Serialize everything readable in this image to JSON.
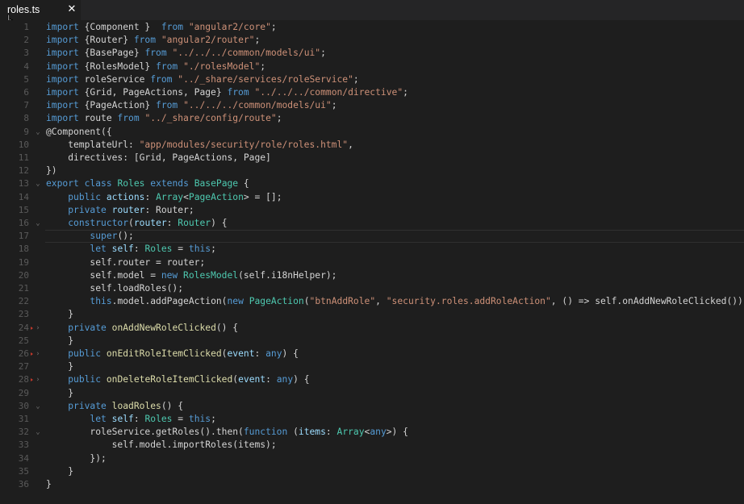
{
  "tab": {
    "title": "roles.ts",
    "close_glyph": "✕"
  },
  "colors": {
    "background": "#1e1e1e",
    "tabbar": "#252526",
    "line_number": "#5a5a5a",
    "keyword": "#569cd6",
    "type": "#4ec9b0",
    "string": "#ce9178",
    "function": "#dcdcaa",
    "text": "#d4d4d4",
    "marker": "#c0392b"
  },
  "lines": [
    {
      "n": "1",
      "tokens": [
        [
          "kw",
          "import"
        ],
        [
          "pu",
          " {Component }  "
        ],
        [
          "kw",
          "from"
        ],
        [
          "pu",
          " "
        ],
        [
          "str",
          "\"angular2/core\""
        ],
        [
          "pu",
          ";"
        ]
      ]
    },
    {
      "n": "2",
      "tokens": [
        [
          "kw",
          "import"
        ],
        [
          "pu",
          " {Router} "
        ],
        [
          "kw",
          "from"
        ],
        [
          "pu",
          " "
        ],
        [
          "str",
          "\"angular2/router\""
        ],
        [
          "pu",
          ";"
        ]
      ]
    },
    {
      "n": "3",
      "tokens": [
        [
          "kw",
          "import"
        ],
        [
          "pu",
          " {BasePage} "
        ],
        [
          "kw",
          "from"
        ],
        [
          "pu",
          " "
        ],
        [
          "str",
          "\"../../../common/models/ui\""
        ],
        [
          "pu",
          ";"
        ]
      ]
    },
    {
      "n": "4",
      "tokens": [
        [
          "kw",
          "import"
        ],
        [
          "pu",
          " {RolesModel} "
        ],
        [
          "kw",
          "from"
        ],
        [
          "pu",
          " "
        ],
        [
          "str",
          "\"./rolesModel\""
        ],
        [
          "pu",
          ";"
        ]
      ]
    },
    {
      "n": "5",
      "tokens": [
        [
          "kw",
          "import"
        ],
        [
          "pu",
          " roleService "
        ],
        [
          "kw",
          "from"
        ],
        [
          "pu",
          " "
        ],
        [
          "str",
          "\"../_share/services/roleService\""
        ],
        [
          "pu",
          ";"
        ]
      ]
    },
    {
      "n": "6",
      "tokens": [
        [
          "kw",
          "import"
        ],
        [
          "pu",
          " {Grid, PageActions, Page} "
        ],
        [
          "kw",
          "from"
        ],
        [
          "pu",
          " "
        ],
        [
          "str",
          "\"../../../common/directive\""
        ],
        [
          "pu",
          ";"
        ]
      ]
    },
    {
      "n": "7",
      "tokens": [
        [
          "kw",
          "import"
        ],
        [
          "pu",
          " {PageAction} "
        ],
        [
          "kw",
          "from"
        ],
        [
          "pu",
          " "
        ],
        [
          "str",
          "\"../../../common/models/ui\""
        ],
        [
          "pu",
          ";"
        ]
      ]
    },
    {
      "n": "8",
      "tokens": [
        [
          "kw",
          "import"
        ],
        [
          "pu",
          " route "
        ],
        [
          "kw",
          "from"
        ],
        [
          "pu",
          " "
        ],
        [
          "str",
          "\"../_share/config/route\""
        ],
        [
          "pu",
          ";"
        ]
      ]
    },
    {
      "n": "9",
      "fold": "⌄",
      "tokens": [
        [
          "pu",
          "@Component({"
        ]
      ]
    },
    {
      "n": "10",
      "tokens": [
        [
          "pu",
          "    templateUrl: "
        ],
        [
          "str",
          "\"app/modules/security/role/roles.html\""
        ],
        [
          "pu",
          ","
        ]
      ]
    },
    {
      "n": "11",
      "tokens": [
        [
          "pu",
          "    directives: [Grid, PageActions, Page]"
        ]
      ]
    },
    {
      "n": "12",
      "tokens": [
        [
          "pu",
          "})"
        ]
      ]
    },
    {
      "n": "13",
      "fold": "⌄",
      "tokens": [
        [
          "kw",
          "export"
        ],
        [
          "pu",
          " "
        ],
        [
          "kw",
          "class"
        ],
        [
          "pu",
          " "
        ],
        [
          "ty",
          "Roles"
        ],
        [
          "pu",
          " "
        ],
        [
          "kw",
          "extends"
        ],
        [
          "pu",
          " "
        ],
        [
          "ty",
          "BasePage"
        ],
        [
          "pu",
          " {"
        ]
      ]
    },
    {
      "n": "14",
      "tokens": [
        [
          "pu",
          "    "
        ],
        [
          "kw",
          "public"
        ],
        [
          "pu",
          " "
        ],
        [
          "pm",
          "actions"
        ],
        [
          "pu",
          ": "
        ],
        [
          "ty",
          "Array"
        ],
        [
          "pu",
          "<"
        ],
        [
          "ty",
          "PageAction"
        ],
        [
          "pu",
          "> = [];"
        ]
      ]
    },
    {
      "n": "15",
      "tokens": [
        [
          "pu",
          "    "
        ],
        [
          "kw",
          "private"
        ],
        [
          "pu",
          " "
        ],
        [
          "pm",
          "router"
        ],
        [
          "pu",
          ": Router;"
        ]
      ]
    },
    {
      "n": "16",
      "fold": "⌄",
      "tokens": [
        [
          "pu",
          "    "
        ],
        [
          "kw",
          "constructor"
        ],
        [
          "pu",
          "("
        ],
        [
          "pm",
          "router"
        ],
        [
          "pu",
          ": "
        ],
        [
          "ty",
          "Router"
        ],
        [
          "pu",
          ") {"
        ]
      ]
    },
    {
      "n": "17",
      "current": true,
      "tokens": [
        [
          "pu",
          "        "
        ],
        [
          "kw",
          "super"
        ],
        [
          "pu",
          "();"
        ]
      ]
    },
    {
      "n": "18",
      "tokens": [
        [
          "pu",
          "        "
        ],
        [
          "kw",
          "let"
        ],
        [
          "pu",
          " "
        ],
        [
          "pm",
          "self"
        ],
        [
          "pu",
          ": "
        ],
        [
          "ty",
          "Roles"
        ],
        [
          "pu",
          " = "
        ],
        [
          "kw",
          "this"
        ],
        [
          "pu",
          ";"
        ]
      ]
    },
    {
      "n": "19",
      "tokens": [
        [
          "pu",
          "        self.router = router;"
        ]
      ]
    },
    {
      "n": "20",
      "tokens": [
        [
          "pu",
          "        self.model = "
        ],
        [
          "kw",
          "new"
        ],
        [
          "pu",
          " "
        ],
        [
          "ty",
          "RolesModel"
        ],
        [
          "pu",
          "(self.i18nHelper);"
        ]
      ]
    },
    {
      "n": "21",
      "tokens": [
        [
          "pu",
          "        self.loadRoles();"
        ]
      ]
    },
    {
      "n": "22",
      "tokens": [
        [
          "pu",
          "        "
        ],
        [
          "kw",
          "this"
        ],
        [
          "pu",
          ".model.addPageAction("
        ],
        [
          "kw",
          "new"
        ],
        [
          "pu",
          " "
        ],
        [
          "ty",
          "PageAction"
        ],
        [
          "pu",
          "("
        ],
        [
          "str",
          "\"btnAddRole\""
        ],
        [
          "pu",
          ", "
        ],
        [
          "str",
          "\"security.roles.addRoleAction\""
        ],
        [
          "pu",
          ", () => self.onAddNewRoleClicked()));"
        ]
      ]
    },
    {
      "n": "23",
      "tokens": [
        [
          "pu",
          "    }"
        ]
      ]
    },
    {
      "n": "24",
      "fold": "›",
      "marker": true,
      "tokens": [
        [
          "pu",
          "    "
        ],
        [
          "kw",
          "private"
        ],
        [
          "pu",
          " "
        ],
        [
          "fn",
          "onAddNewRoleClicked"
        ],
        [
          "pu",
          "() {"
        ]
      ]
    },
    {
      "n": "25",
      "tokens": [
        [
          "pu",
          "    }"
        ]
      ]
    },
    {
      "n": "26",
      "fold": "›",
      "marker": true,
      "tokens": [
        [
          "pu",
          "    "
        ],
        [
          "kw",
          "public"
        ],
        [
          "pu",
          " "
        ],
        [
          "fn",
          "onEditRoleItemClicked"
        ],
        [
          "pu",
          "("
        ],
        [
          "pm",
          "event"
        ],
        [
          "pu",
          ": "
        ],
        [
          "kw",
          "any"
        ],
        [
          "pu",
          ") {"
        ]
      ]
    },
    {
      "n": "27",
      "tokens": [
        [
          "pu",
          "    }"
        ]
      ]
    },
    {
      "n": "28",
      "fold": "›",
      "marker": true,
      "tokens": [
        [
          "pu",
          "    "
        ],
        [
          "kw",
          "public"
        ],
        [
          "pu",
          " "
        ],
        [
          "fn",
          "onDeleteRoleItemClicked"
        ],
        [
          "pu",
          "("
        ],
        [
          "pm",
          "event"
        ],
        [
          "pu",
          ": "
        ],
        [
          "kw",
          "any"
        ],
        [
          "pu",
          ") {"
        ]
      ]
    },
    {
      "n": "29",
      "tokens": [
        [
          "pu",
          "    }"
        ]
      ]
    },
    {
      "n": "30",
      "fold": "⌄",
      "tokens": [
        [
          "pu",
          "    "
        ],
        [
          "kw",
          "private"
        ],
        [
          "pu",
          " "
        ],
        [
          "fn",
          "loadRoles"
        ],
        [
          "pu",
          "() {"
        ]
      ]
    },
    {
      "n": "31",
      "tokens": [
        [
          "pu",
          "        "
        ],
        [
          "kw",
          "let"
        ],
        [
          "pu",
          " "
        ],
        [
          "pm",
          "self"
        ],
        [
          "pu",
          ": "
        ],
        [
          "ty",
          "Roles"
        ],
        [
          "pu",
          " = "
        ],
        [
          "kw",
          "this"
        ],
        [
          "pu",
          ";"
        ]
      ]
    },
    {
      "n": "32",
      "fold": "⌄",
      "tokens": [
        [
          "pu",
          "        roleService.getRoles().then("
        ],
        [
          "kw",
          "function"
        ],
        [
          "pu",
          " ("
        ],
        [
          "pm",
          "items"
        ],
        [
          "pu",
          ": "
        ],
        [
          "ty",
          "Array"
        ],
        [
          "pu",
          "<"
        ],
        [
          "kw",
          "any"
        ],
        [
          "pu",
          ">) {"
        ]
      ]
    },
    {
      "n": "33",
      "tokens": [
        [
          "pu",
          "            self.model.importRoles(items);"
        ]
      ]
    },
    {
      "n": "34",
      "tokens": [
        [
          "pu",
          "        });"
        ]
      ]
    },
    {
      "n": "35",
      "tokens": [
        [
          "pu",
          "    }"
        ]
      ]
    },
    {
      "n": "36",
      "tokens": [
        [
          "pu",
          "}"
        ]
      ]
    }
  ]
}
